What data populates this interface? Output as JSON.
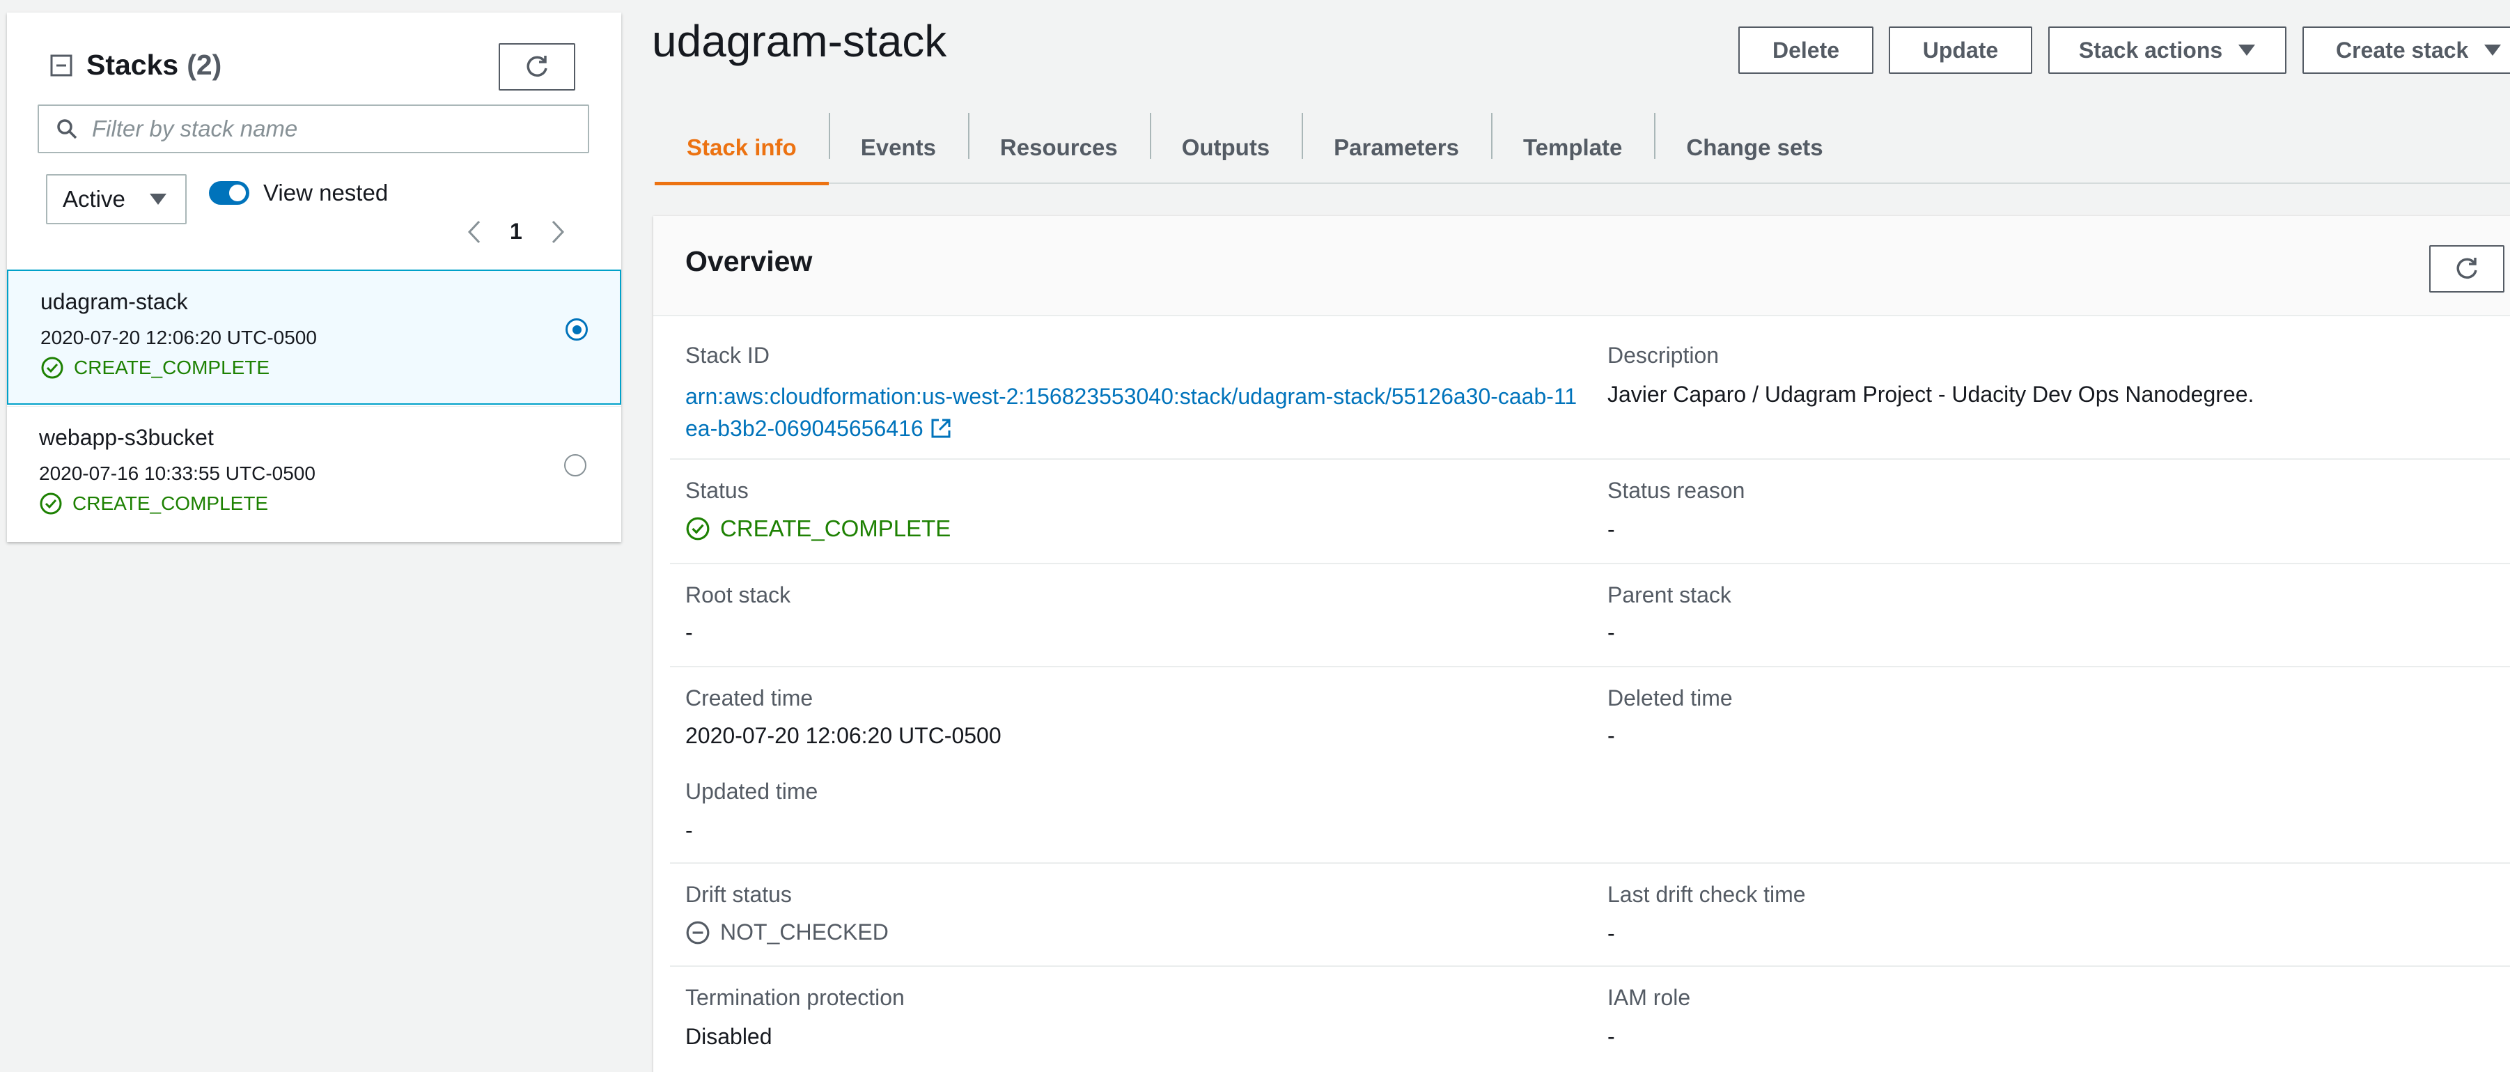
{
  "sidebar": {
    "title": "Stacks",
    "count": "(2)",
    "filter_placeholder": "Filter by stack name",
    "status_filter": "Active",
    "view_nested_label": "View nested",
    "page": "1",
    "stacks": [
      {
        "name": "udagram-stack",
        "date": "2020-07-20 12:06:20 UTC-0500",
        "status": "CREATE_COMPLETE",
        "selected": true
      },
      {
        "name": "webapp-s3bucket",
        "date": "2020-07-16 10:33:55 UTC-0500",
        "status": "CREATE_COMPLETE",
        "selected": false
      }
    ]
  },
  "header": {
    "title": "udagram-stack",
    "delete_label": "Delete",
    "update_label": "Update",
    "stack_actions_label": "Stack actions",
    "create_stack_label": "Create stack"
  },
  "tabs": [
    {
      "label": "Stack info",
      "active": true
    },
    {
      "label": "Events"
    },
    {
      "label": "Resources"
    },
    {
      "label": "Outputs"
    },
    {
      "label": "Parameters"
    },
    {
      "label": "Template"
    },
    {
      "label": "Change sets"
    }
  ],
  "overview": {
    "title": "Overview",
    "stack_id_label": "Stack ID",
    "stack_id": "arn:aws:cloudformation:us-west-2:156823553040:stack/udagram-stack/55126a30-caab-11ea-b3b2-069045656416",
    "description_label": "Description",
    "description": "Javier Caparo / Udagram Project - Udacity Dev Ops Nanodegree.",
    "status_label": "Status",
    "status": "CREATE_COMPLETE",
    "status_reason_label": "Status reason",
    "status_reason": "-",
    "root_stack_label": "Root stack",
    "root_stack": "-",
    "parent_stack_label": "Parent stack",
    "parent_stack": "-",
    "created_time_label": "Created time",
    "created_time": "2020-07-20 12:06:20 UTC-0500",
    "deleted_time_label": "Deleted time",
    "deleted_time": "-",
    "updated_time_label": "Updated time",
    "updated_time": "-",
    "drift_status_label": "Drift status",
    "drift_status": "NOT_CHECKED",
    "last_drift_check_label": "Last drift check time",
    "last_drift_check": "-",
    "termination_protection_label": "Termination protection",
    "termination_protection": "Disabled",
    "iam_role_label": "IAM role",
    "iam_role": "-"
  },
  "colors": {
    "accent": "#ec7211",
    "link": "#0073bb",
    "success": "#1d8102",
    "selected_bg": "#f1faff"
  }
}
